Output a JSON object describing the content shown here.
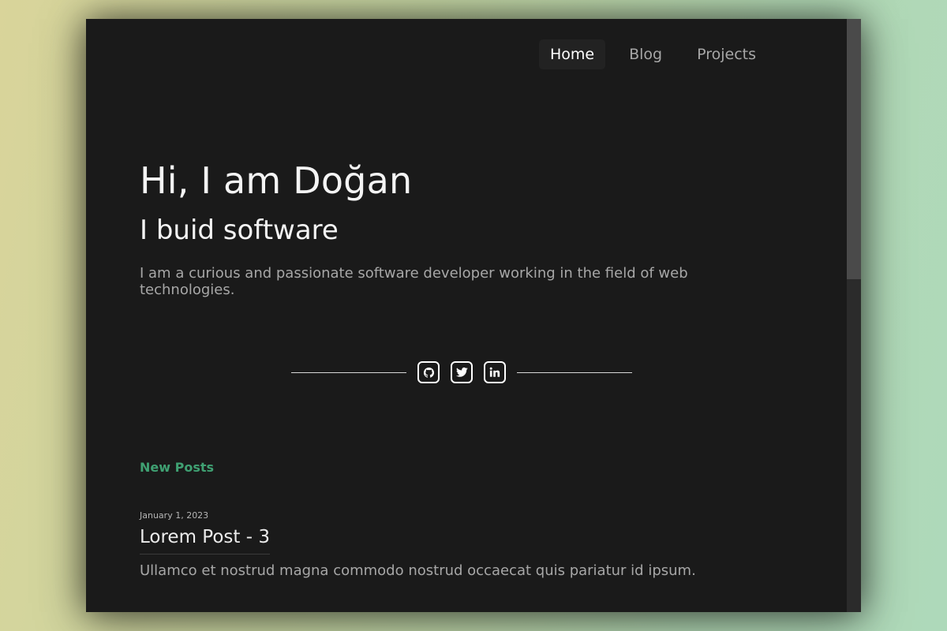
{
  "nav": {
    "items": [
      {
        "label": "Home",
        "active": true
      },
      {
        "label": "Blog",
        "active": false
      },
      {
        "label": "Projects",
        "active": false
      }
    ]
  },
  "hero": {
    "greeting": "Hi, I am Doğan",
    "tagline": "I buid software",
    "description": "I am a curious and passionate software developer working in the field of web technologies."
  },
  "social": {
    "icons": [
      "github-icon",
      "twitter-icon",
      "linkedin-icon"
    ]
  },
  "posts": {
    "section_title": "New Posts",
    "items": [
      {
        "date": "January 1, 2023",
        "title": "Lorem Post - 3",
        "excerpt": "Ullamco et nostrud magna commodo nostrud occaecat quis pariatur id ipsum."
      }
    ]
  },
  "colors": {
    "background": "#1a1a1a",
    "accent": "#3fa072",
    "text_primary": "#f4f4f4",
    "text_muted": "#a7a7a7"
  }
}
